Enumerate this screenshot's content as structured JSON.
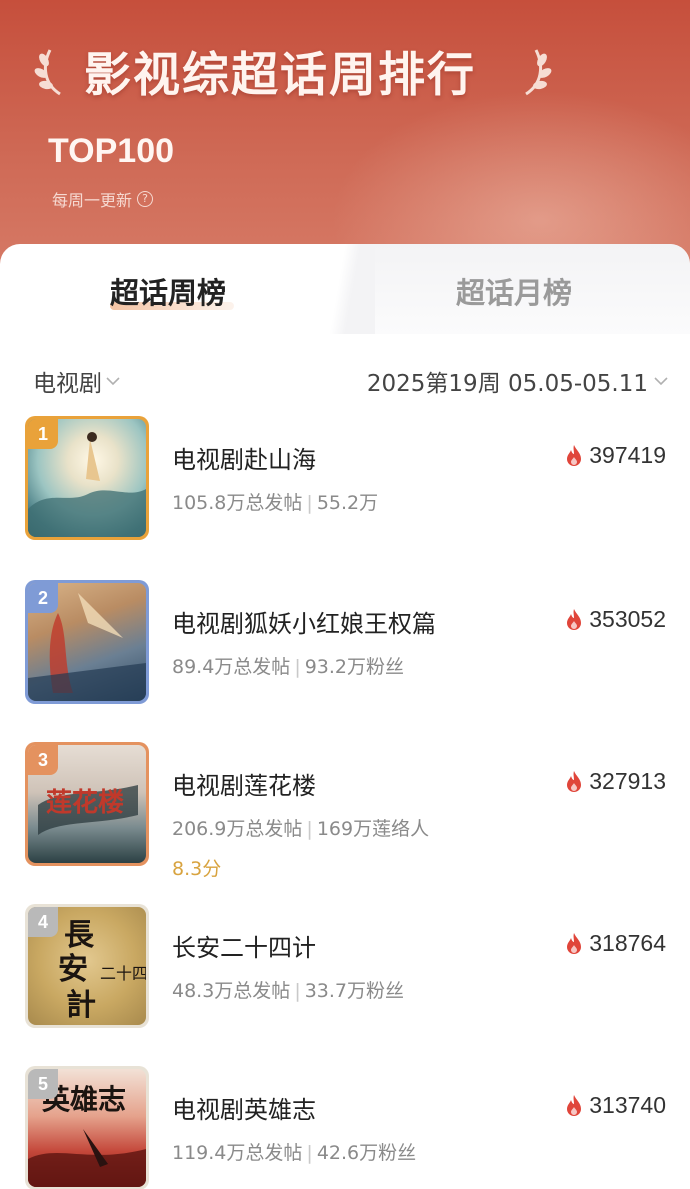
{
  "header": {
    "title": "影视综超话周排行",
    "subtitle": "TOP100",
    "update_text": "每周一更新",
    "help_icon": "question-circle-icon"
  },
  "tabs": [
    {
      "label": "超话周榜",
      "active": true
    },
    {
      "label": "超话月榜",
      "active": false
    }
  ],
  "filters": {
    "category": "电视剧",
    "week": "2025第19周 05.05-05.11"
  },
  "items": [
    {
      "rank": "1",
      "name": "电视剧赴山海",
      "posts": "105.8万总发帖",
      "fans": "55.2万",
      "heat": "397419",
      "rank_color": "#e9a23a"
    },
    {
      "rank": "2",
      "name": "电视剧狐妖小红娘王权篇",
      "posts": "89.4万总发帖",
      "fans": "93.2万粉丝",
      "heat": "353052",
      "rank_color": "#7f9bd6"
    },
    {
      "rank": "3",
      "name": "电视剧莲花楼",
      "posts": "206.9万总发帖",
      "fans": "169万莲络人",
      "score": "8.3分",
      "heat": "327913",
      "rank_color": "#e4925f"
    },
    {
      "rank": "4",
      "name": "长安二十四计",
      "posts": "48.3万总发帖",
      "fans": "33.7万粉丝",
      "heat": "318764",
      "rank_color": "#b9b9b9"
    },
    {
      "rank": "5",
      "name": "电视剧英雄志",
      "posts": "119.4万总发帖",
      "fans": "42.6万粉丝",
      "heat": "313740",
      "rank_color": "#b9b9b9"
    }
  ],
  "colors": {
    "header_bg": "#c85a47",
    "heat_icon": "#e0453a",
    "score": "#d8a33f"
  }
}
